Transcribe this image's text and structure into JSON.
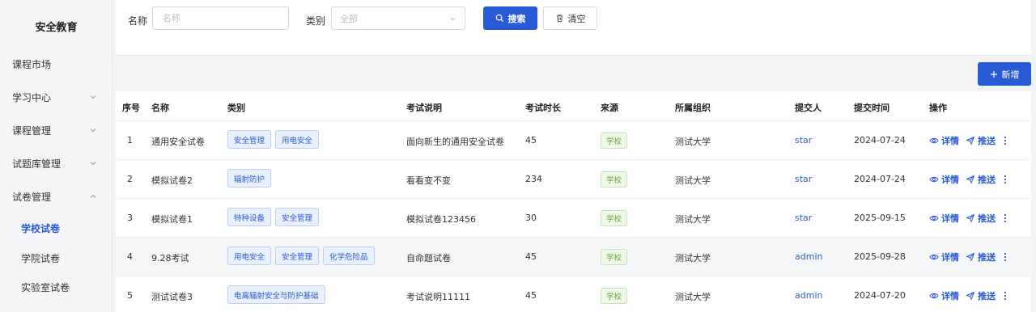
{
  "sidebar": {
    "title": "安全教育",
    "items": [
      {
        "label": "课程市场",
        "expandable": false
      },
      {
        "label": "学习中心",
        "expandable": true,
        "expanded": false
      },
      {
        "label": "课程管理",
        "expandable": true,
        "expanded": false
      },
      {
        "label": "试题库管理",
        "expandable": true,
        "expanded": false
      },
      {
        "label": "试卷管理",
        "expandable": true,
        "expanded": true
      }
    ],
    "subitems": [
      {
        "label": "学校试卷",
        "active": true
      },
      {
        "label": "学院试卷",
        "active": false
      },
      {
        "label": "实验室试卷",
        "active": false
      }
    ]
  },
  "filters": {
    "name_label": "名称",
    "name_placeholder": "名称",
    "name_value": "",
    "category_label": "类别",
    "category_placeholder": "全部",
    "search_label": "搜索",
    "clear_label": "清空"
  },
  "toolbar": {
    "add_label": "新增"
  },
  "table": {
    "headers": {
      "index": "序号",
      "name": "名称",
      "category": "类别",
      "description": "考试说明",
      "duration": "考试时长",
      "source": "来源",
      "org": "所属组织",
      "submitter": "提交人",
      "submit_time": "提交时间",
      "actions": "操作"
    },
    "action_labels": {
      "detail": "详情",
      "push": "推送"
    },
    "rows": [
      {
        "index": "1",
        "name": "通用安全试卷",
        "tags": [
          "安全管理",
          "用电安全"
        ],
        "description": "面向新生的通用安全试卷",
        "duration": "45",
        "source": "学校",
        "org": "测试大学",
        "submitter": "star",
        "submit_time": "2024-07-24"
      },
      {
        "index": "2",
        "name": "模拟试卷2",
        "tags": [
          "辐射防护"
        ],
        "description": "看看变不变",
        "duration": "234",
        "source": "学校",
        "org": "测试大学",
        "submitter": "star",
        "submit_time": "2024-07-24"
      },
      {
        "index": "3",
        "name": "模拟试卷1",
        "tags": [
          "特种设备",
          "安全管理"
        ],
        "description": "模拟试卷123456",
        "duration": "30",
        "source": "学校",
        "org": "测试大学",
        "submitter": "star",
        "submit_time": "2025-09-15"
      },
      {
        "index": "4",
        "name": "9.28考试",
        "tags": [
          "用电安全",
          "安全管理",
          "化学危险品"
        ],
        "description": "自命题试卷",
        "duration": "45",
        "source": "学校",
        "org": "测试大学",
        "submitter": "admin",
        "submit_time": "2025-09-28"
      },
      {
        "index": "5",
        "name": "测试试卷3",
        "tags": [
          "电离辐射安全与防护基础"
        ],
        "description": "考试说明11111",
        "duration": "45",
        "source": "学校",
        "org": "测试大学",
        "submitter": "admin",
        "submit_time": "2024-07-20"
      }
    ],
    "highlighted_row": 3
  },
  "colors": {
    "primary": "#2a5bd7",
    "tag_bg": "#eaf1fd",
    "badge_green": "#6aaa3d",
    "sidebar_bg": "#f4f5f7"
  },
  "icons": {
    "search": "search-icon",
    "clear": "trash-icon",
    "add": "plus-icon",
    "detail": "eye-icon",
    "push": "send-icon",
    "more": "more-vertical-icon",
    "chevron": "chevron-icon"
  }
}
